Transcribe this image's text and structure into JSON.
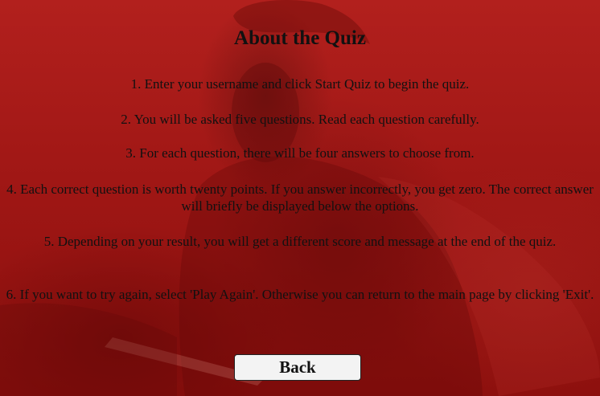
{
  "page": {
    "title": "About the Quiz",
    "rules": [
      "1. Enter your username and click Start Quiz to begin the quiz.",
      "2. You will be asked five questions. Read each question carefully.",
      "3. For each question, there will be four answers to choose from.",
      "4. Each correct question is worth twenty points. If you answer incorrectly, you get zero. The correct answer will briefly be displayed below the options.",
      "5. Depending on your result, you will get a different score and message at the end of the quiz.",
      "6. If you want to try again, select 'Play Again'. Otherwise you can return to the main page by clicking 'Exit'."
    ],
    "back_label": "Back"
  },
  "colors": {
    "background": "#a01715",
    "text": "#111111",
    "button_bg": "#f3f3f3"
  }
}
